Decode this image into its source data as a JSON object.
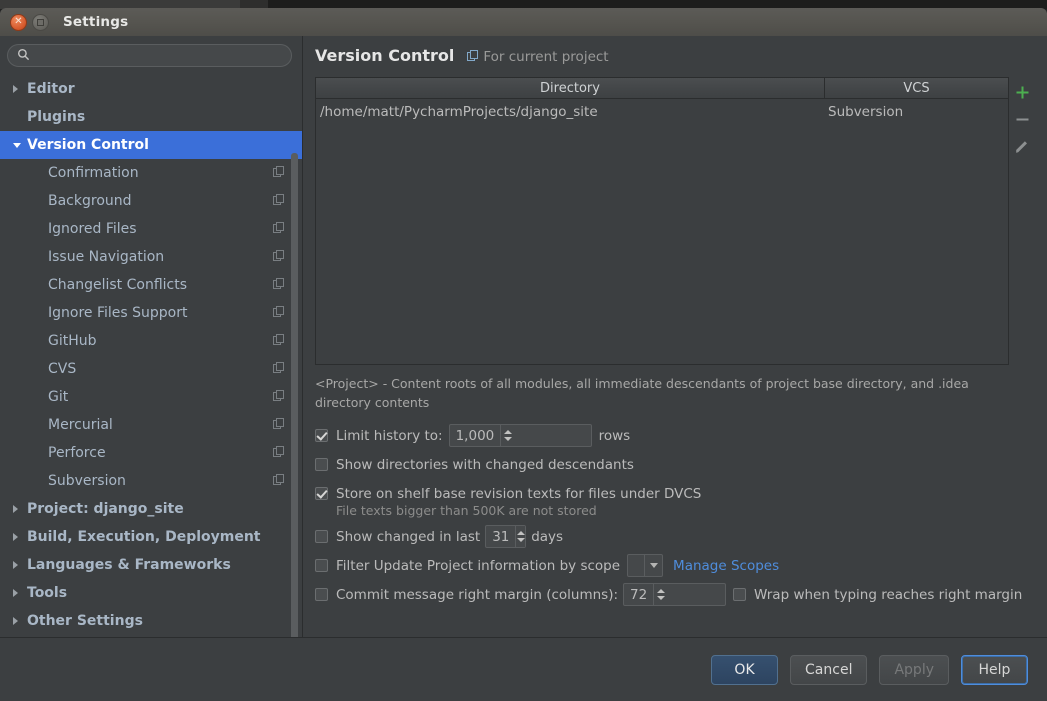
{
  "window": {
    "title": "Settings",
    "close_icon": "close-icon",
    "maximize_icon": "maximize-icon"
  },
  "search": {
    "placeholder": "",
    "value": "",
    "icon": "search-icon"
  },
  "sidebar": {
    "scope_icon": "project-scope-icon",
    "items": [
      {
        "label": "Editor",
        "level": "top",
        "expanded": false,
        "selected": false,
        "scope_icon": false
      },
      {
        "label": "Plugins",
        "level": "top",
        "expanded": null,
        "selected": false,
        "scope_icon": false
      },
      {
        "label": "Version Control",
        "level": "top",
        "expanded": true,
        "selected": true,
        "scope_icon": false
      },
      {
        "label": "Confirmation",
        "level": "child",
        "expanded": null,
        "selected": false,
        "scope_icon": true
      },
      {
        "label": "Background",
        "level": "child",
        "expanded": null,
        "selected": false,
        "scope_icon": true
      },
      {
        "label": "Ignored Files",
        "level": "child",
        "expanded": null,
        "selected": false,
        "scope_icon": true
      },
      {
        "label": "Issue Navigation",
        "level": "child",
        "expanded": null,
        "selected": false,
        "scope_icon": true
      },
      {
        "label": "Changelist Conflicts",
        "level": "child",
        "expanded": null,
        "selected": false,
        "scope_icon": true
      },
      {
        "label": "Ignore Files Support",
        "level": "child",
        "expanded": null,
        "selected": false,
        "scope_icon": true
      },
      {
        "label": "GitHub",
        "level": "child",
        "expanded": null,
        "selected": false,
        "scope_icon": true
      },
      {
        "label": "CVS",
        "level": "child",
        "expanded": null,
        "selected": false,
        "scope_icon": true
      },
      {
        "label": "Git",
        "level": "child",
        "expanded": null,
        "selected": false,
        "scope_icon": true
      },
      {
        "label": "Mercurial",
        "level": "child",
        "expanded": null,
        "selected": false,
        "scope_icon": true
      },
      {
        "label": "Perforce",
        "level": "child",
        "expanded": null,
        "selected": false,
        "scope_icon": true
      },
      {
        "label": "Subversion",
        "level": "child",
        "expanded": null,
        "selected": false,
        "scope_icon": true
      },
      {
        "label": "Project: django_site",
        "level": "top",
        "expanded": false,
        "selected": false,
        "scope_icon": false
      },
      {
        "label": "Build, Execution, Deployment",
        "level": "top",
        "expanded": false,
        "selected": false,
        "scope_icon": false
      },
      {
        "label": "Languages & Frameworks",
        "level": "top",
        "expanded": false,
        "selected": false,
        "scope_icon": false
      },
      {
        "label": "Tools",
        "level": "top",
        "expanded": false,
        "selected": false,
        "scope_icon": false
      },
      {
        "label": "Other Settings",
        "level": "top",
        "expanded": false,
        "selected": false,
        "scope_icon": false
      }
    ]
  },
  "main": {
    "title": "Version Control",
    "subtitle": "For current project",
    "subtitle_icon": "project-scope-icon",
    "table": {
      "columns": [
        "Directory",
        "VCS"
      ],
      "rows": [
        {
          "directory": "/home/matt/PycharmProjects/django_site",
          "vcs": "Subversion"
        }
      ],
      "tools": [
        {
          "name": "add-directory-button",
          "icon": "plus-icon",
          "color": "#4caf50"
        },
        {
          "name": "remove-directory-button",
          "icon": "minus-icon",
          "color": "#8d9091"
        },
        {
          "name": "edit-directory-button",
          "icon": "pencil-icon",
          "color": "#8d9091"
        }
      ]
    },
    "description": "<Project> - Content roots of all modules, all immediate descendants of project base directory, and .idea directory contents",
    "options": {
      "limit_history": {
        "label": "Limit history to:",
        "checked": true,
        "value": "1,000",
        "suffix": "rows"
      },
      "show_dirs_changed_descendants": {
        "label": "Show directories with changed descendants",
        "checked": false
      },
      "store_on_shelf": {
        "label": "Store on shelf base revision texts for files under DVCS",
        "checked": true,
        "hint": "File texts bigger than 500K are not stored"
      },
      "show_changed_in_last": {
        "label": "Show changed in last",
        "checked": false,
        "value": "31",
        "suffix": "days"
      },
      "filter_by_scope": {
        "label": "Filter Update Project information by scope",
        "checked": false,
        "scope_value": "",
        "link": "Manage Scopes"
      },
      "commit_right_margin": {
        "label": "Commit message right margin (columns):",
        "checked": false,
        "value": "72"
      },
      "wrap_when_typing": {
        "label": "Wrap when typing reaches right margin",
        "checked": false
      }
    }
  },
  "footer": {
    "buttons": [
      {
        "label": "OK",
        "name": "ok-button",
        "style": "primary"
      },
      {
        "label": "Cancel",
        "name": "cancel-button",
        "style": "normal"
      },
      {
        "label": "Apply",
        "name": "apply-button",
        "style": "disabled"
      },
      {
        "label": "Help",
        "name": "help-button",
        "style": "focus"
      }
    ]
  },
  "colors": {
    "accent_selection": "#3b6fd9",
    "link": "#4f8ddc",
    "add_green": "#4caf50",
    "panel_bg": "#3c3f41",
    "titlebar_bg": "#55544f"
  }
}
